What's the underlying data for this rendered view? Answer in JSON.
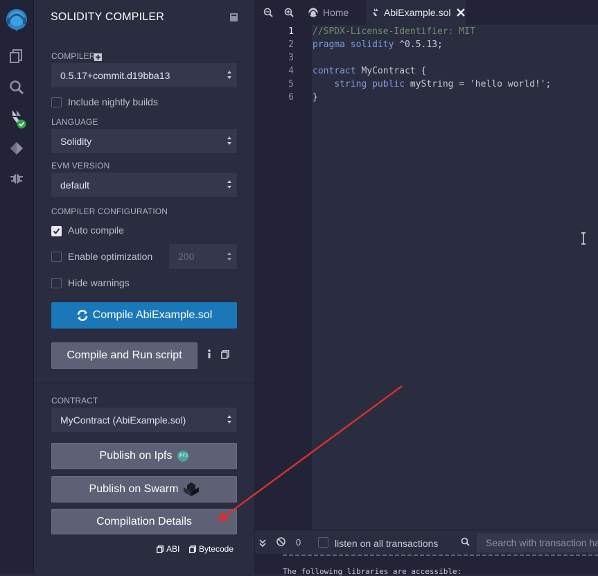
{
  "sidebar": {
    "icons": [
      "remix-logo-icon",
      "file-explorer-icon",
      "search-icon",
      "solidity-compiler-icon",
      "deploy-run-icon",
      "debugger-icon"
    ]
  },
  "panel": {
    "title": "SOLIDITY COMPILER",
    "compiler_label": "COMPILER",
    "compiler_version": "0.5.17+commit.d19bba13",
    "nightly_label": "Include nightly builds",
    "nightly_checked": false,
    "language_label": "LANGUAGE",
    "language_value": "Solidity",
    "evm_label": "EVM VERSION",
    "evm_value": "default",
    "config_label": "COMPILER CONFIGURATION",
    "auto_compile_label": "Auto compile",
    "auto_compile_checked": true,
    "optimization_label": "Enable optimization",
    "optimization_checked": false,
    "optimization_runs": "200",
    "hide_warnings_label": "Hide warnings",
    "hide_warnings_checked": false,
    "compile_button": "Compile AbiExample.sol",
    "compile_run_button": "Compile and Run script",
    "contract_label": "CONTRACT",
    "contract_value": "MyContract (AbiExample.sol)",
    "publish_ipfs": "Publish on Ipfs",
    "ipfs_badge": "IPFS",
    "publish_swarm": "Publish on Swarm",
    "compilation_details": "Compilation Details",
    "abi_label": "ABI",
    "bytecode_label": "Bytecode"
  },
  "editor": {
    "tabs": [
      {
        "label": "Home"
      },
      {
        "label": "AbiExample.sol",
        "active": true
      }
    ],
    "lines": [
      "1",
      "2",
      "3",
      "4",
      "5",
      "6"
    ],
    "code": {
      "l1": "//SPDX-License-Identifier: MIT",
      "l2_kw": "pragma solidity",
      "l2_rest": " ^0.5.13;",
      "l4_kw": "contract",
      "l4_rest": " MyContract {",
      "l5_indent": "    ",
      "l5_kw": "string public",
      "l5_rest": " myString = 'hello world!';",
      "l6": "}"
    }
  },
  "terminal": {
    "count": "0",
    "listen_label": "listen on all transactions",
    "search_placeholder": "Search with transaction hash",
    "text_line": "The following libraries are accessible:"
  },
  "colors": {
    "accent_blue": "#1b78b8",
    "annotation_arrow": "#d62f2f"
  }
}
